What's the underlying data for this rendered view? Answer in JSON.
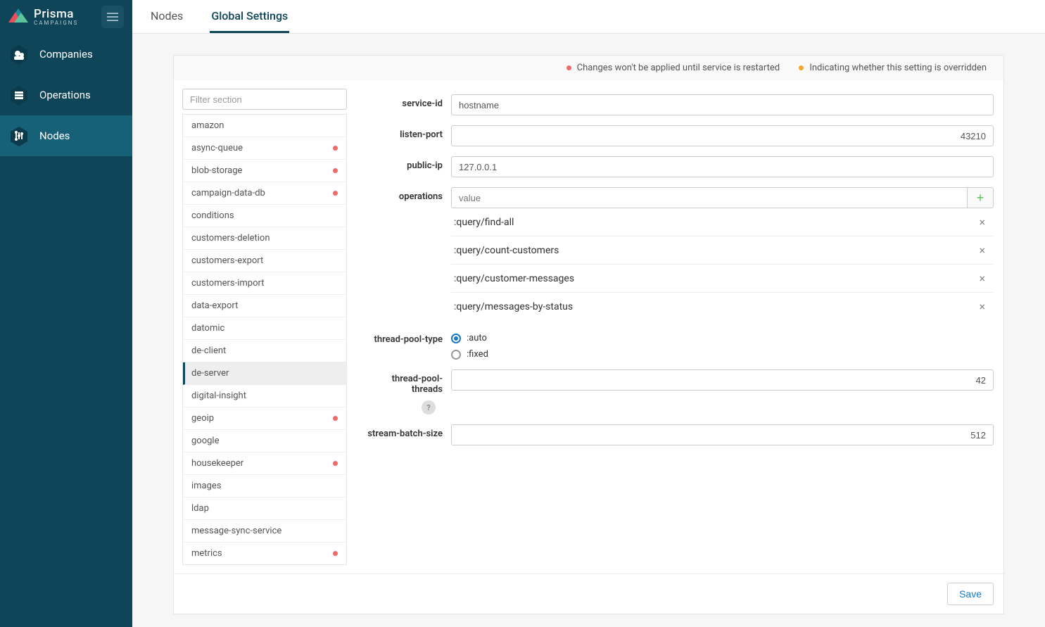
{
  "brand": {
    "name": "Prisma",
    "subtitle": "CAMPAIGNS"
  },
  "sidebar": {
    "items": [
      {
        "label": "Companies"
      },
      {
        "label": "Operations"
      },
      {
        "label": "Nodes"
      }
    ]
  },
  "tabs": [
    {
      "label": "Nodes",
      "active": false
    },
    {
      "label": "Global Settings",
      "active": true
    }
  ],
  "notices": {
    "restart": "Changes won't be applied until service is restarted",
    "overridden": "Indicating whether this setting is overridden"
  },
  "filter": {
    "placeholder": "Filter section"
  },
  "sections": [
    {
      "name": "amazon",
      "restart": false
    },
    {
      "name": "async-queue",
      "restart": true
    },
    {
      "name": "blob-storage",
      "restart": true
    },
    {
      "name": "campaign-data-db",
      "restart": true
    },
    {
      "name": "conditions",
      "restart": false
    },
    {
      "name": "customers-deletion",
      "restart": false
    },
    {
      "name": "customers-export",
      "restart": false
    },
    {
      "name": "customers-import",
      "restart": false
    },
    {
      "name": "data-export",
      "restart": false
    },
    {
      "name": "datomic",
      "restart": false
    },
    {
      "name": "de-client",
      "restart": false
    },
    {
      "name": "de-server",
      "restart": false,
      "selected": true
    },
    {
      "name": "digital-insight",
      "restart": false
    },
    {
      "name": "geoip",
      "restart": true
    },
    {
      "name": "google",
      "restart": false
    },
    {
      "name": "housekeeper",
      "restart": true
    },
    {
      "name": "images",
      "restart": false
    },
    {
      "name": "ldap",
      "restart": false
    },
    {
      "name": "message-sync-service",
      "restart": false
    },
    {
      "name": "metrics",
      "restart": true
    }
  ],
  "form": {
    "service_id": {
      "label": "service-id",
      "value": "hostname"
    },
    "listen_port": {
      "label": "listen-port",
      "value": "43210"
    },
    "public_ip": {
      "label": "public-ip",
      "value": "127.0.0.1"
    },
    "operations": {
      "label": "operations",
      "placeholder": "value",
      "items": [
        ":query/find-all",
        ":query/count-customers",
        ":query/customer-messages",
        ":query/messages-by-status"
      ]
    },
    "thread_pool_type": {
      "label": "thread-pool-type",
      "options": [
        ":auto",
        ":fixed"
      ],
      "selected": ":auto"
    },
    "thread_pool_threads": {
      "label": "thread-pool-threads",
      "value": "42",
      "help": "?"
    },
    "stream_batch_size": {
      "label": "stream-batch-size",
      "value": "512"
    }
  },
  "buttons": {
    "save": "Save"
  }
}
